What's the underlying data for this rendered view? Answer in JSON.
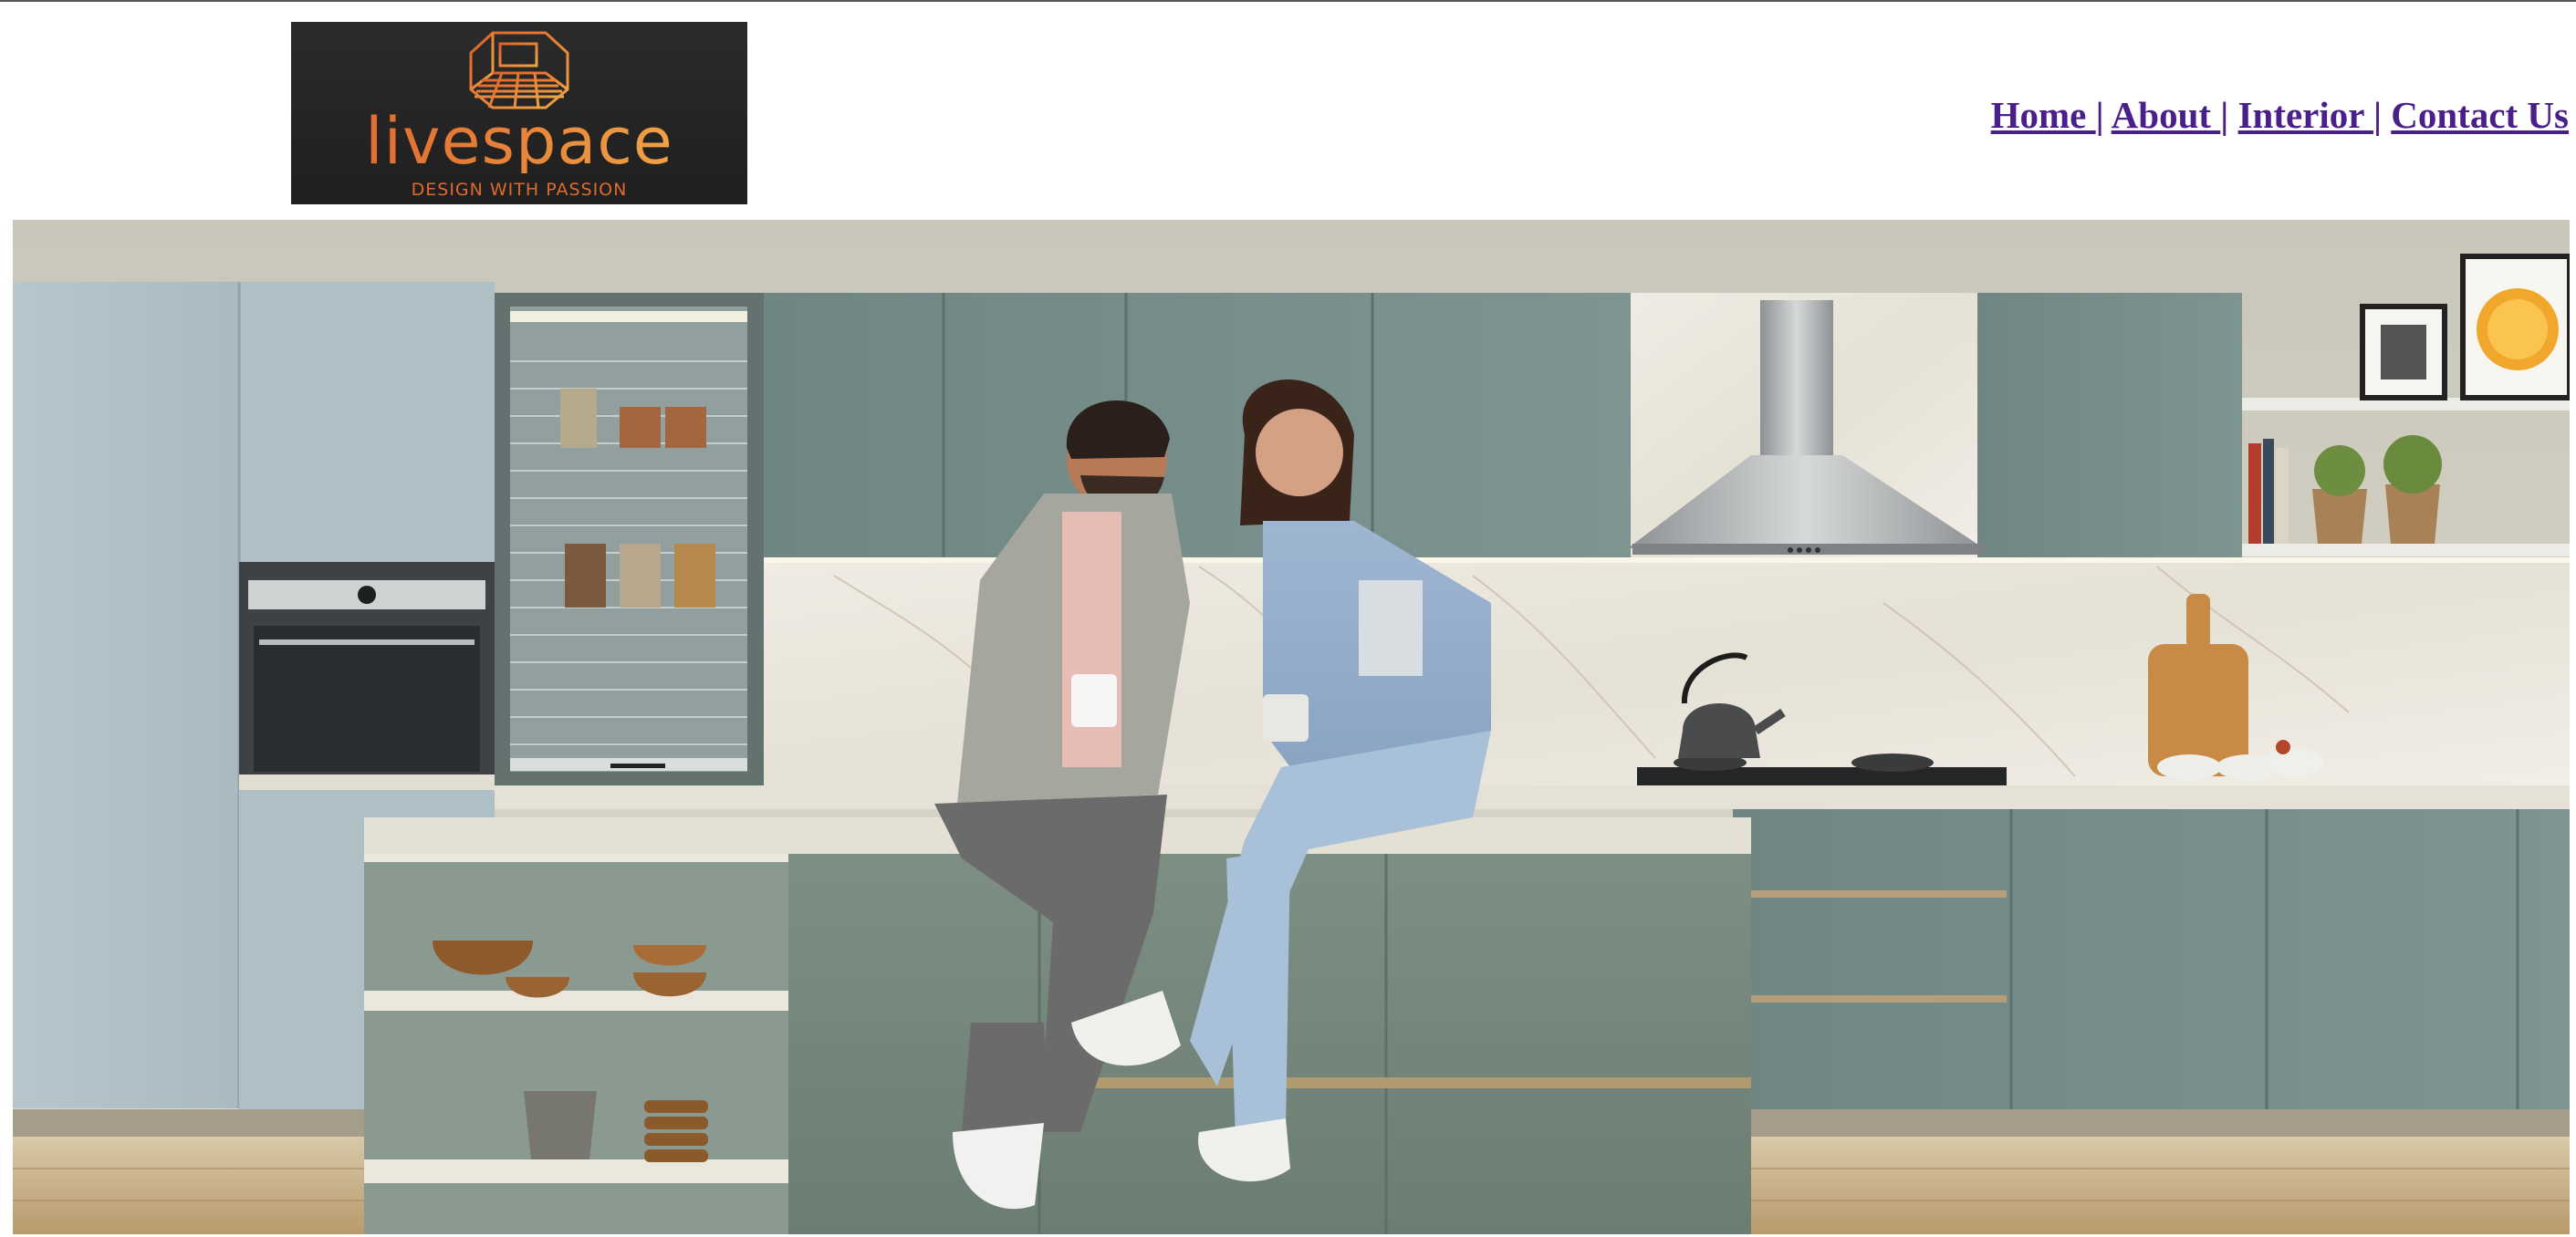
{
  "brand": {
    "name": "livespace",
    "tagline": "DESIGN WITH PASSION",
    "colors": {
      "logo_bg": "#242424",
      "logo_orange": "#e0612a",
      "logo_gold": "#f3b149"
    }
  },
  "nav": {
    "items": [
      {
        "label": "Home "
      },
      {
        "label": "About "
      },
      {
        "label": "Interior "
      },
      {
        "label": "Contact Us"
      }
    ],
    "separator": "|",
    "link_color": "#4a1f8a"
  },
  "hero": {
    "icon": "kitchen-hero-image",
    "description_icon": "modular-kitchen-photo"
  }
}
